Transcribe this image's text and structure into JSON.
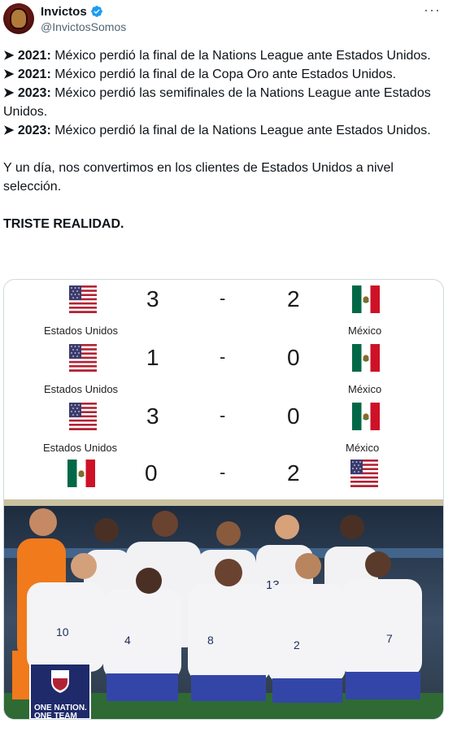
{
  "tweet": {
    "display_name": "Invictos",
    "handle": "@InvictosSomos",
    "more_icon": "ellipsis-icon",
    "lines": [
      {
        "bold": "➤ 2021:",
        "text": " México perdió la final de la Nations League ante Estados Unidos."
      },
      {
        "bold": "➤ 2021:",
        "text": " México perdió la final de la Copa Oro ante Estados Unidos."
      },
      {
        "bold": "➤ 2023:",
        "text": " México perdió las semifinales de la Nations League ante Estados Unidos."
      },
      {
        "bold": "➤ 2023:",
        "text": " México perdió la final de la Nations League ante Estados Unidos."
      }
    ],
    "closing": "Y un día, nos convertimos en los clientes de Estados Unidos a nivel selección.",
    "emphasis": "TRISTE REALIDAD."
  },
  "scoreboard": {
    "dash": "-",
    "rows": [
      {
        "left_flag": "usa-flag-icon",
        "left_score": "3",
        "right_score": "2",
        "right_flag": "mexico-flag-icon",
        "left_team": "Estados Unidos",
        "right_team": "México"
      },
      {
        "left_flag": "usa-flag-icon",
        "left_score": "1",
        "right_score": "0",
        "right_flag": "mexico-flag-icon",
        "left_team": "Estados Unidos",
        "right_team": "México"
      },
      {
        "left_flag": "usa-flag-icon",
        "left_score": "3",
        "right_score": "0",
        "right_flag": "mexico-flag-icon",
        "left_team": "Estados Unidos",
        "right_team": "México"
      },
      {
        "left_flag": "mexico-flag-icon",
        "left_score": "0",
        "right_score": "2",
        "right_flag": "usa-flag-icon",
        "left_team": "",
        "right_team": ""
      }
    ]
  },
  "photo": {
    "banner_line1": "ONE NATION.",
    "banner_line2": "ONE TEAM",
    "jersey_numbers": [
      "13",
      "10",
      "4",
      "8",
      "2",
      "7"
    ]
  },
  "colors": {
    "verified_blue": "#1d9bf0",
    "mexico_green": "#006847",
    "mexico_red": "#ce1126",
    "usa_blue": "#3c3b6e",
    "usa_red": "#b22234",
    "keeper_orange": "#f07a1c"
  }
}
